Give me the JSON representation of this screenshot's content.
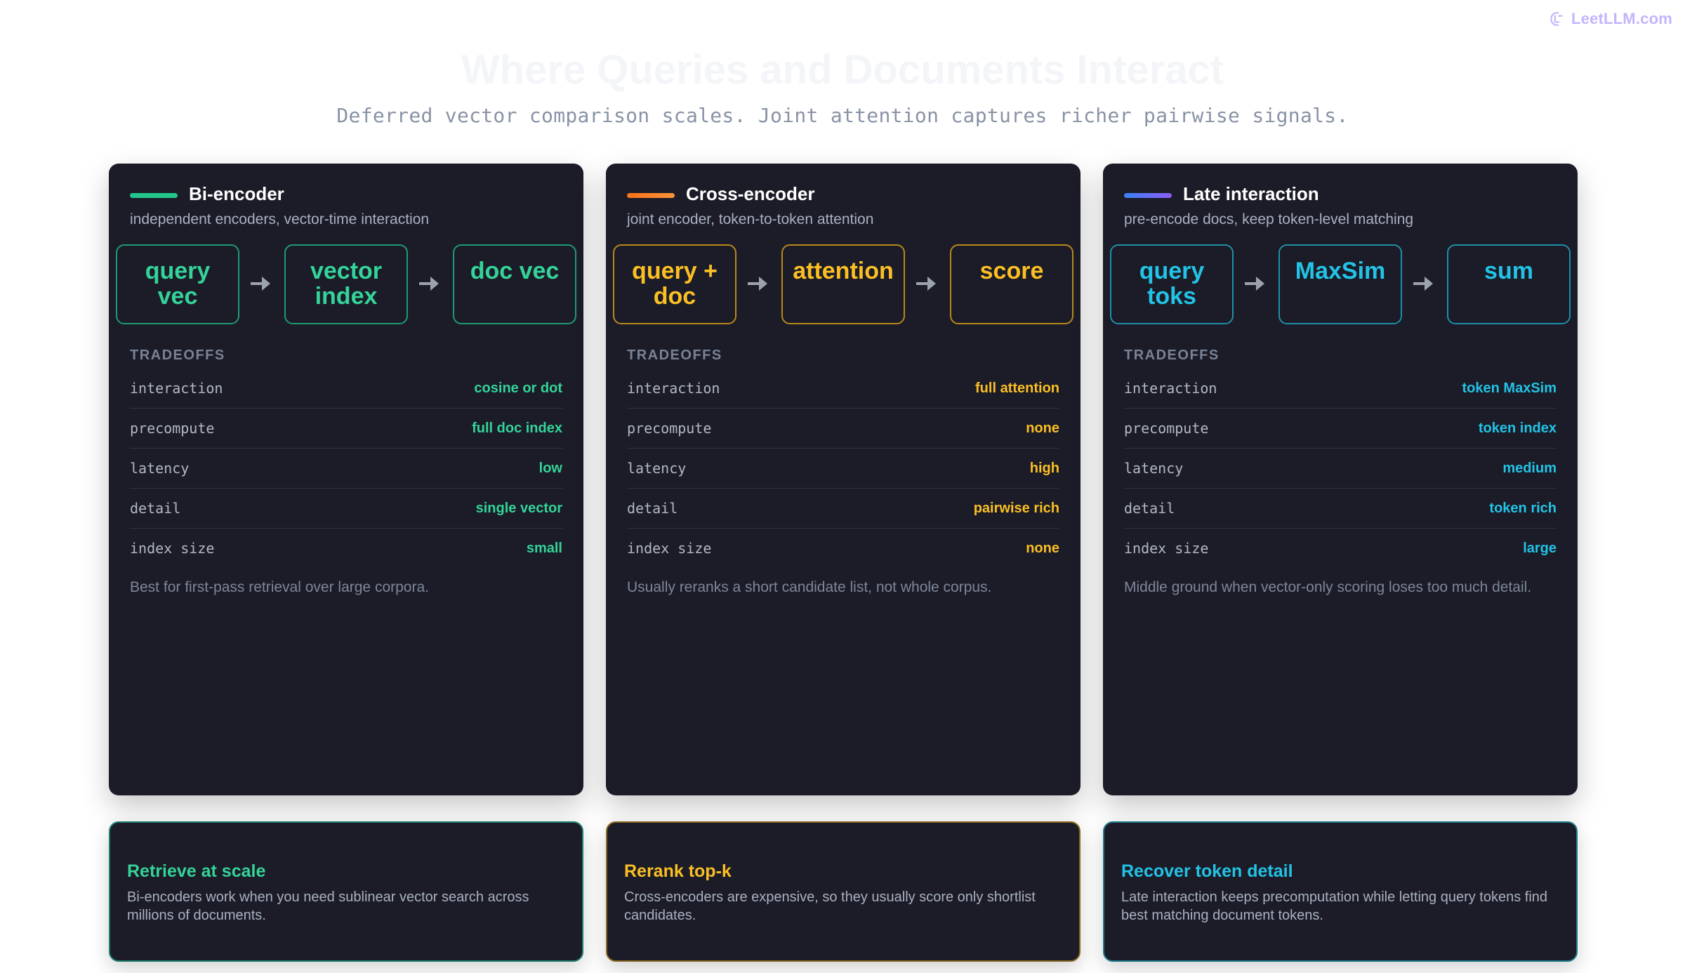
{
  "brand": {
    "name": "LeetLLM.com"
  },
  "header": {
    "title": "Where Queries and Documents Interact",
    "subtitle": "Deferred vector comparison scales. Joint attention captures richer pairwise signals."
  },
  "cards": [
    {
      "title": "Bi-encoder",
      "subtitle": "independent encoders, vector-time interaction",
      "accent": "#22c58b",
      "flow": [
        {
          "line1": "query",
          "line2": "vec"
        },
        {
          "line1": "vector",
          "line2": "index"
        },
        {
          "line1": "doc vec",
          "line2": ""
        }
      ],
      "tradeoffs_label": "TRADEOFFS",
      "tradeoffs": [
        {
          "key": "interaction",
          "value": "cosine or dot"
        },
        {
          "key": "precompute",
          "value": "full doc index"
        },
        {
          "key": "latency",
          "value": "low"
        },
        {
          "key": "detail",
          "value": "single vector"
        },
        {
          "key": "index size",
          "value": "small"
        }
      ],
      "note": "Best for first-pass retrieval over large corpora."
    },
    {
      "title": "Cross-encoder",
      "subtitle": "joint encoder, token-to-token attention",
      "accent": "#fbbf24",
      "flow": [
        {
          "line1": "query +",
          "line2": "doc"
        },
        {
          "line1": "attention",
          "line2": ""
        },
        {
          "line1": "score",
          "line2": ""
        }
      ],
      "tradeoffs_label": "TRADEOFFS",
      "tradeoffs": [
        {
          "key": "interaction",
          "value": "full attention"
        },
        {
          "key": "precompute",
          "value": "none"
        },
        {
          "key": "latency",
          "value": "high"
        },
        {
          "key": "detail",
          "value": "pairwise rich"
        },
        {
          "key": "index size",
          "value": "none"
        }
      ],
      "note": "Usually reranks a short candidate list, not whole corpus."
    },
    {
      "title": "Late interaction",
      "subtitle": "pre-encode docs, keep token-level matching",
      "accent": "#22c3e6",
      "flow": [
        {
          "line1": "query",
          "line2": "toks"
        },
        {
          "line1": "MaxSim",
          "line2": ""
        },
        {
          "line1": "sum",
          "line2": ""
        }
      ],
      "tradeoffs_label": "TRADEOFFS",
      "tradeoffs": [
        {
          "key": "interaction",
          "value": "token MaxSim"
        },
        {
          "key": "precompute",
          "value": "token index"
        },
        {
          "key": "latency",
          "value": "medium"
        },
        {
          "key": "detail",
          "value": "token rich"
        },
        {
          "key": "index size",
          "value": "large"
        }
      ],
      "note": "Middle ground when vector-only scoring loses too much detail."
    }
  ],
  "bottom_cards": [
    {
      "title": "Retrieve at scale",
      "text": "Bi-encoders work when you need sublinear vector search across millions of documents."
    },
    {
      "title": "Rerank top-k",
      "text": "Cross-encoders are expensive, so they usually score only shortlist candidates."
    },
    {
      "title": "Recover token detail",
      "text": "Late interaction keeps precomputation while letting query tokens find best matching document tokens."
    }
  ]
}
